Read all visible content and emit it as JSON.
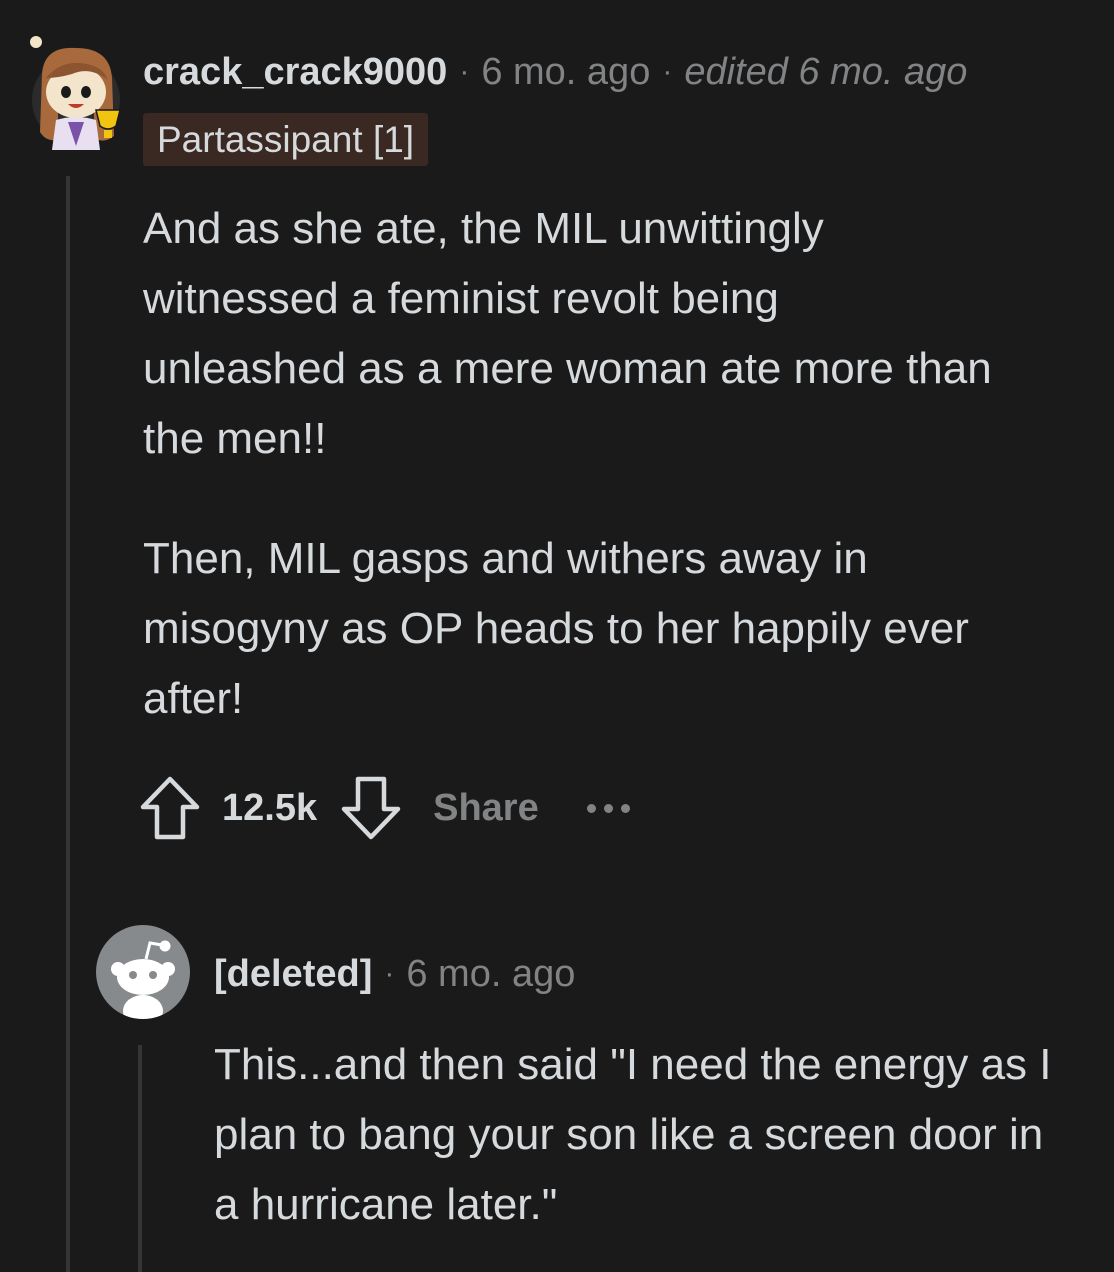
{
  "comment": {
    "author": "crack_crack9000",
    "time": "6 mo. ago",
    "edited": "edited 6 mo. ago",
    "flair": "Partassipant [1]",
    "paragraphs": [
      "And as she ate, the MIL unwittingly witnessed a feminist revolt being unleashed as a mere woman ate more than the men!!",
      "Then, MIL gasps and withers away in misogyny as OP heads to her happily ever after!"
    ],
    "score": "12.5k",
    "share_label": "Share",
    "icons": {
      "upvote": "upvote-arrow-icon",
      "downvote": "downvote-arrow-icon",
      "more": "more-dots-icon"
    }
  },
  "reply": {
    "author": "[deleted]",
    "time": "6 mo. ago",
    "paragraphs": [
      "This...and then said \"I need the energy as I plan to bang your son like a screen door in a hurricane later.\""
    ]
  },
  "colors": {
    "background": "#1a1a1b",
    "text": "#d7dadc",
    "meta": "#818384",
    "flair_bg": "#3a2823",
    "thread_line": "#343536",
    "deleted_avatar": "#878a8c"
  }
}
